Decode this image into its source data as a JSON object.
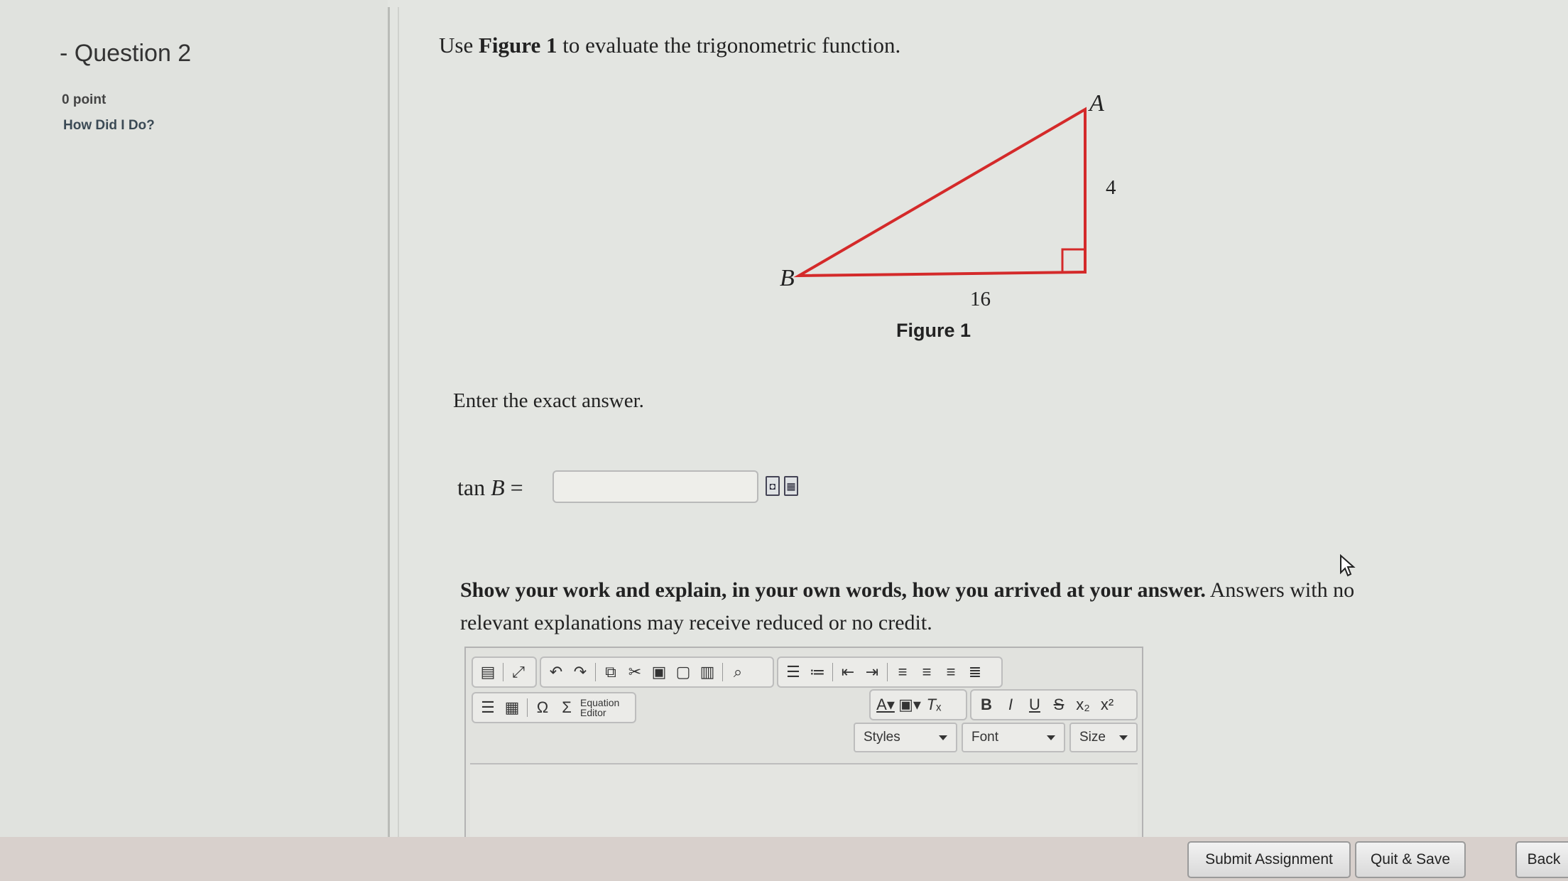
{
  "question": {
    "title": "- Question 2",
    "points": "0 point",
    "how_did_i_do": "How Did I Do?"
  },
  "prompt": {
    "prefix": "Use ",
    "figure_ref": "Figure 1",
    "suffix": " to evaluate the trigonometric function."
  },
  "figure": {
    "vertex_a": "A",
    "vertex_b": "B",
    "side_vertical": "4",
    "side_horizontal": "16",
    "caption": "Figure 1",
    "line_color": "#d42a2a"
  },
  "instruction": "Enter the exact answer.",
  "answer": {
    "label_func": "tan ",
    "label_var": "B",
    "label_eq": " =",
    "value": ""
  },
  "work": {
    "bold_text": "Show your work and explain, in your own words, how you arrived at your answer.",
    "rest_text": " Answers with no relevant explanations may receive reduced or no credit."
  },
  "editor": {
    "equation_line1": "Equation",
    "equation_line2": "Editor",
    "styles": "Styles",
    "font": "Font",
    "size": "Size"
  },
  "footer": {
    "submit": "Submit Assignment",
    "quit_save": "Quit & Save",
    "back": "Back"
  }
}
